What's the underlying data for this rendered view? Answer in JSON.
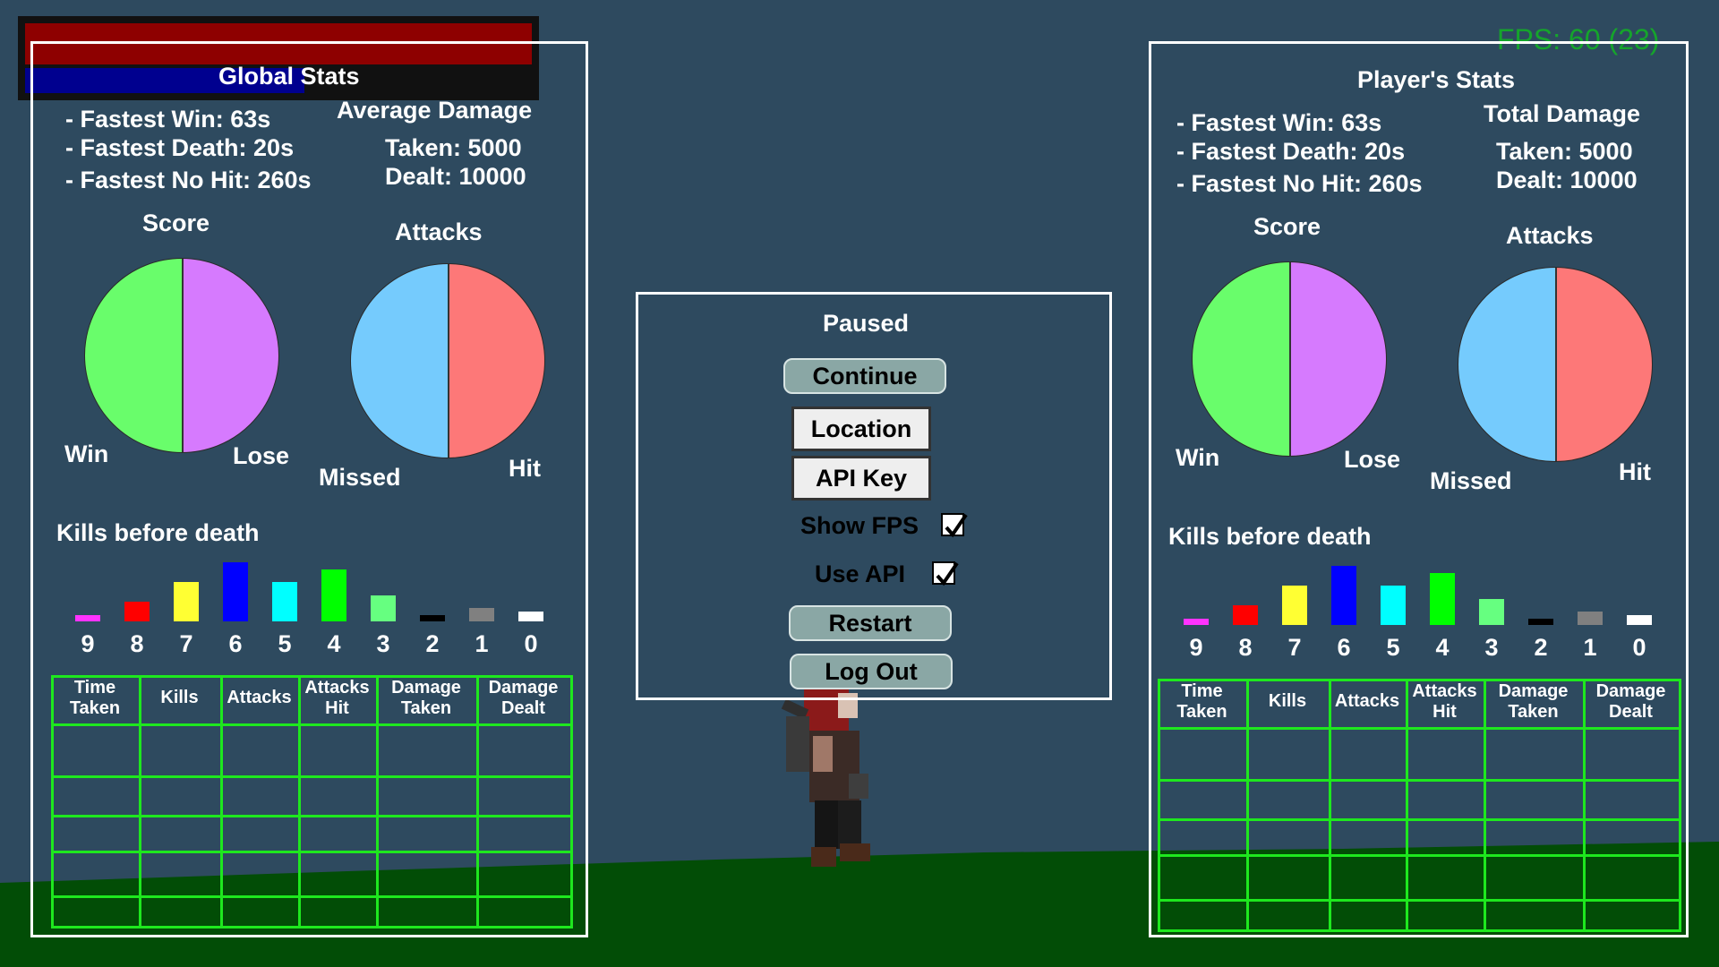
{
  "hud": {
    "fps_text": "FPS: 60 (23)",
    "health_fraction": 1.0,
    "mana_fraction": 0.55
  },
  "colors": {
    "sky": "#2e4a5f",
    "ground": "#024d06",
    "table_green": "#1ee81e",
    "win": "#69fd6b",
    "lose": "#d67afe",
    "missed": "#75cbfd",
    "hit": "#fd7878"
  },
  "global": {
    "title": "Global Stats",
    "fastest_win": "- Fastest Win: 63s",
    "fastest_death": "- Fastest Death: 20s",
    "fastest_nohit": "- Fastest No Hit: 260s",
    "damage_heading": "Average Damage",
    "taken": "Taken: 5000",
    "dealt": "Dealt: 10000",
    "score_title": "Score",
    "attacks_title": "Attacks",
    "win": "Win",
    "lose": "Lose",
    "missed": "Missed",
    "hit": "Hit",
    "kills_title": "Kills before death"
  },
  "player": {
    "title": "Player's Stats",
    "fastest_win": "- Fastest Win: 63s",
    "fastest_death": "- Fastest Death: 20s",
    "fastest_nohit": "- Fastest No Hit: 260s",
    "damage_heading": "Total Damage",
    "taken": "Taken: 5000",
    "dealt": "Dealt: 10000",
    "score_title": "Score",
    "attacks_title": "Attacks",
    "win": "Win",
    "lose": "Lose",
    "missed": "Missed",
    "hit": "Hit",
    "kills_title": "Kills before death"
  },
  "kills_chart": {
    "type": "bar",
    "categories": [
      "9",
      "8",
      "7",
      "6",
      "5",
      "4",
      "3",
      "2",
      "1",
      "0"
    ],
    "values": [
      1,
      3,
      6,
      9,
      6,
      8,
      4,
      1,
      2,
      1.5
    ],
    "colors": [
      "#ff33ff",
      "#ff0000",
      "#ffff33",
      "#0000ff",
      "#00ffff",
      "#00ff00",
      "#66ff80",
      "#000000",
      "#808080",
      "#ffffff"
    ]
  },
  "table": {
    "headers": [
      [
        "Time",
        "Taken"
      ],
      [
        "Kills"
      ],
      [
        "Attacks"
      ],
      [
        "Attacks",
        "Hit"
      ],
      [
        "Damage",
        "Taken"
      ],
      [
        "Damage",
        "Dealt"
      ]
    ]
  },
  "menu": {
    "title": "Paused",
    "continue": "Continue",
    "location": "Location",
    "api_key": "API Key",
    "show_fps": "Show FPS",
    "show_fps_checked": true,
    "use_api": "Use API",
    "use_api_checked": true,
    "restart": "Restart",
    "logout": "Log Out"
  }
}
